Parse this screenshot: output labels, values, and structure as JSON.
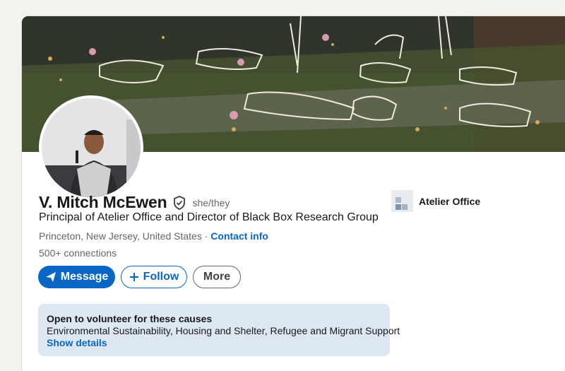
{
  "profile": {
    "name": "V. Mitch McEwen",
    "pronouns": "she/they",
    "headline": "Principal of Atelier Office and Director of Black Box Research Group",
    "location": "Princeton, New Jersey, United States",
    "separator": " · ",
    "contact_label": "Contact info",
    "connections": "500+ connections"
  },
  "actions": {
    "message_label": "Message",
    "follow_label": "Follow",
    "more_label": "More"
  },
  "company": {
    "name": "Atelier Office"
  },
  "volunteer": {
    "title": "Open to volunteer for these causes",
    "causes": "Environmental Sustainability, Housing and Shelter, Refugee and Migrant Support",
    "link_label": "Show details"
  },
  "colors": {
    "accent": "#0a66c2",
    "volunteer_bg": "#dde7f1",
    "page_bg": "#f4f2ee"
  },
  "icons": {
    "verified": "shield-check-icon",
    "message": "paper-plane-icon",
    "follow": "plus-icon"
  }
}
